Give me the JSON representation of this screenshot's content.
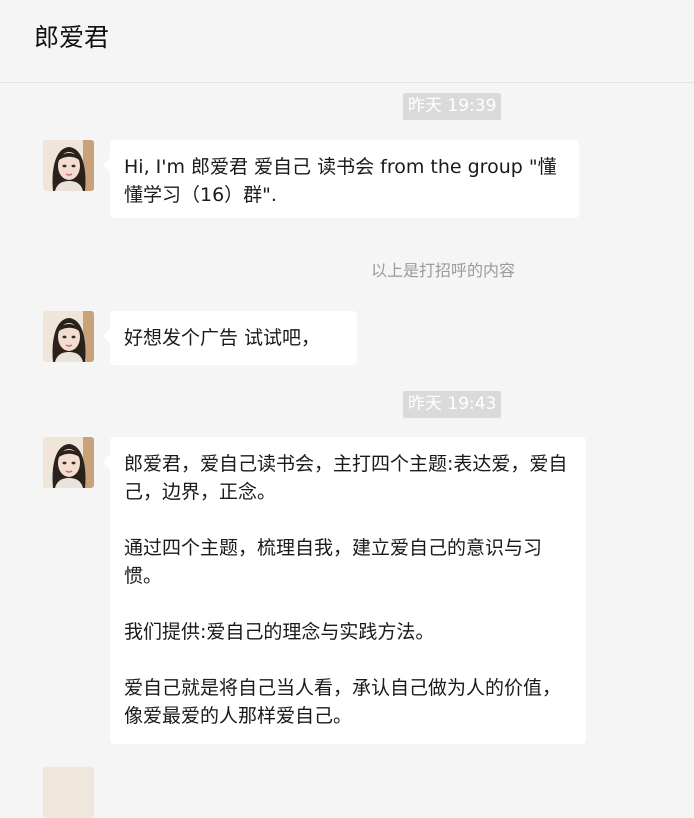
{
  "header": {
    "title": "郎爱君"
  },
  "messages": {
    "ts1": "昨天 19:39",
    "m1": "Hi, I'm 郎爱君  爱自己 读书会 from the group \"懂懂学习（16）群\".",
    "note": "以上是打招呼的内容",
    "m2": "好想发个广告 试试吧，",
    "ts2": "昨天 19:43",
    "m3": [
      "郎爱君，爱自己读书会，主打四个主题:表达爱，爱自己，边界，正念。",
      "通过四个主题，梳理自我，建立爱自己的意识与习惯。",
      "我们提供:爱自己的理念与实践方法。",
      "爱自己就是将自己当人看，承认自己做为人的价值，像爱最爱的人那样爱自己。"
    ]
  },
  "icons": {
    "avatar": "woman-portrait-avatar"
  }
}
